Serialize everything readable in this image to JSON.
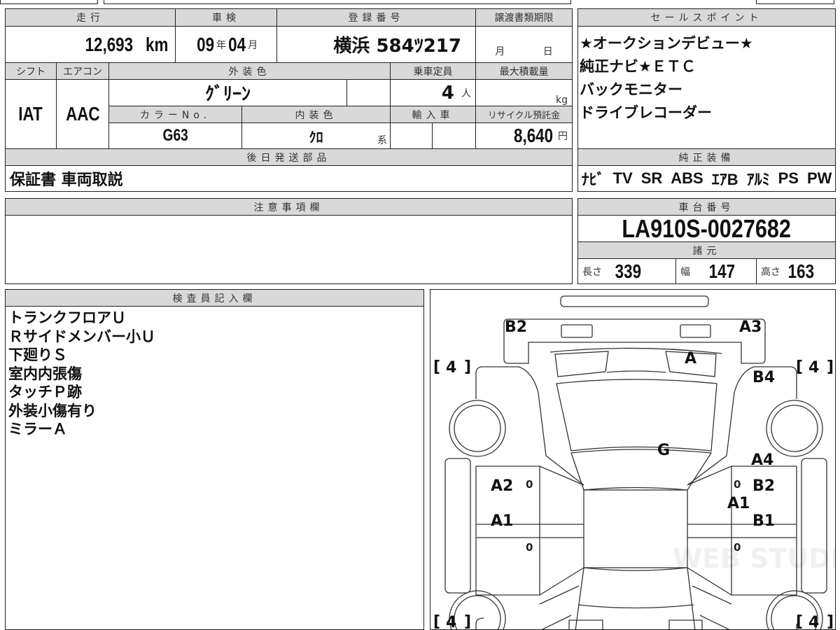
{
  "header": {
    "mileage_label": "走行",
    "shaken_label": "車検",
    "reg_label": "登録番号",
    "transfer_label": "譲渡書類期限",
    "mileage": "12,693",
    "mileage_unit": "km",
    "shaken_year": "09",
    "year_unit": "年",
    "shaken_month": "04",
    "month_unit": "月",
    "registration": "横浜 584ﾂ217",
    "transfer_month": "月",
    "transfer_day": "日"
  },
  "spec": {
    "shift_label": "シフト",
    "ac_label": "エアコン",
    "ext_color_label": "外装色",
    "capacity_label": "乗車定員",
    "max_load_label": "最大積載量",
    "shift": "IAT",
    "ac": "AAC",
    "ext_color": "ｸﾞﾘｰﾝ",
    "capacity": "4",
    "capacity_unit": "人",
    "load_unit": "kg",
    "color_no_label": "カラーNo.",
    "int_color_label": "内装色",
    "import_label": "輸入車",
    "recycle_label": "リサイクル預託金",
    "color_no": "G63",
    "int_color": "ｸﾛ",
    "int_suffix": "系",
    "recycle": "8,640",
    "recycle_unit": "円"
  },
  "parts": {
    "label": "後日発送部品",
    "value": "保証書 車両取説"
  },
  "sales": {
    "label": "セールスポイント",
    "lines": [
      "★オークションデビュー★",
      "純正ナビ★ＥＴＣ",
      "バックモニター",
      "ドライブレコーダー"
    ]
  },
  "equipment": {
    "label": "純正装備",
    "items": [
      "ﾅﾋﾞ",
      "TV",
      "SR",
      "ABS",
      "ｴｱB",
      "ｱﾙﾐ",
      "PS",
      "PW"
    ]
  },
  "notes": {
    "label": "注意事項欄"
  },
  "chassis": {
    "label": "車台番号",
    "value": "LA910S-0027682",
    "dims_label": "諸元",
    "length_label": "長さ",
    "length": "339",
    "width_label": "幅",
    "width": "147",
    "height_label": "高さ",
    "height": "163"
  },
  "inspector": {
    "label": "検査員記入欄",
    "lines": [
      "トランクフロアＵ",
      "Ｒサイドメンバー小Ｕ",
      "下廻りＳ",
      "室内内張傷",
      "タッチＰ跡",
      "外装小傷有り",
      "ミラーＡ"
    ]
  },
  "diagram": {
    "marks": [
      "B2",
      "A3",
      "A",
      "B4",
      "G",
      "A4",
      "A2",
      "B2",
      "A1",
      "A1",
      "B1"
    ],
    "tire": "4",
    "zero": "0",
    "watermark": "WEB STUDIO PRO"
  }
}
